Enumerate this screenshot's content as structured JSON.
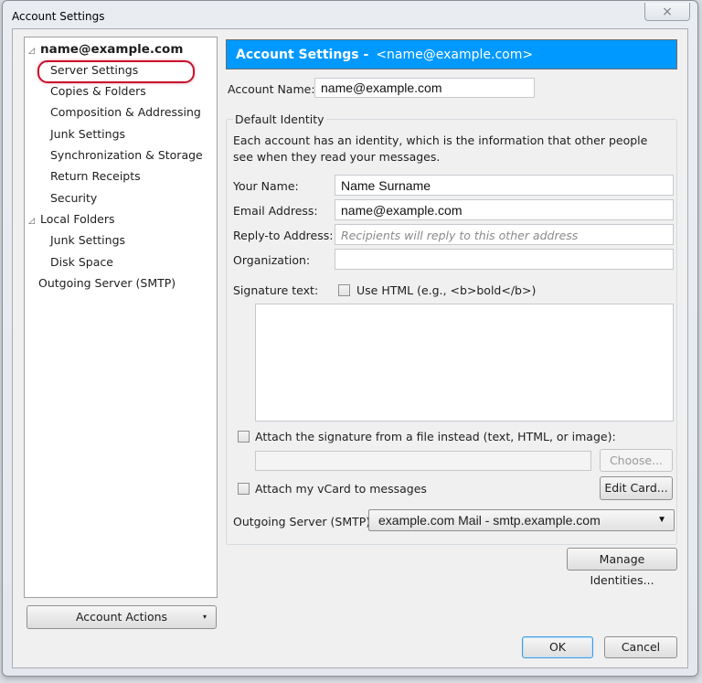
{
  "window": {
    "title": "Account Settings",
    "close_icon": "×"
  },
  "tree": {
    "items": [
      {
        "label": "name@example.com",
        "level": 0,
        "expandable": true
      },
      {
        "label": "Server Settings",
        "level": 1,
        "highlighted": true
      },
      {
        "label": "Copies & Folders",
        "level": 1
      },
      {
        "label": "Composition & Addressing",
        "level": 1
      },
      {
        "label": "Junk Settings",
        "level": 1
      },
      {
        "label": "Synchronization & Storage",
        "level": 1
      },
      {
        "label": "Return Receipts",
        "level": 1
      },
      {
        "label": "Security",
        "level": 1
      },
      {
        "label": "Local Folders",
        "level": 0,
        "expandable": true
      },
      {
        "label": "Junk Settings",
        "level": 1
      },
      {
        "label": "Disk Space",
        "level": 1
      },
      {
        "label": "Outgoing Server (SMTP)",
        "level": 0
      }
    ],
    "twisty_glyph": "◿",
    "account_actions_label": "Account Actions",
    "account_actions_arrow": "▾"
  },
  "panel": {
    "header_title": "Account Settings -",
    "header_sub": "<name@example.com>",
    "header_color": "#0099ff",
    "account_name_label": "Account Name:",
    "account_name_value": "name@example.com",
    "group_caption": "Default Identity",
    "description": "Each account has an identity, which is the information that other people see when they read your messages.",
    "your_name_label": "Your Name:",
    "your_name_value": "Name Surname",
    "email_label": "Email Address:",
    "email_value": "name@example.com",
    "reply_to_label": "Reply-to Address:",
    "reply_to_placeholder": "Recipients will reply to this other address",
    "reply_to_value": "",
    "organization_label": "Organization:",
    "organization_value": "",
    "signature_label": "Signature text:",
    "use_html_label": "Use HTML (e.g., <b>bold</b>)",
    "use_html_checked": false,
    "signature_value": "",
    "attach_sig_label": "Attach the signature from a file instead (text, HTML, or image):",
    "attach_sig_checked": false,
    "choose_label": "Choose...",
    "attach_vcard_label": "Attach my vCard to messages",
    "attach_vcard_checked": false,
    "edit_card_label": "Edit Card...",
    "smtp_label": "Outgoing Server (SMTP):",
    "smtp_selected": "example.com Mail - smtp.example.com",
    "manage_identities_label": "Manage Identities..."
  },
  "footer": {
    "ok_label": "OK",
    "cancel_label": "Cancel"
  }
}
